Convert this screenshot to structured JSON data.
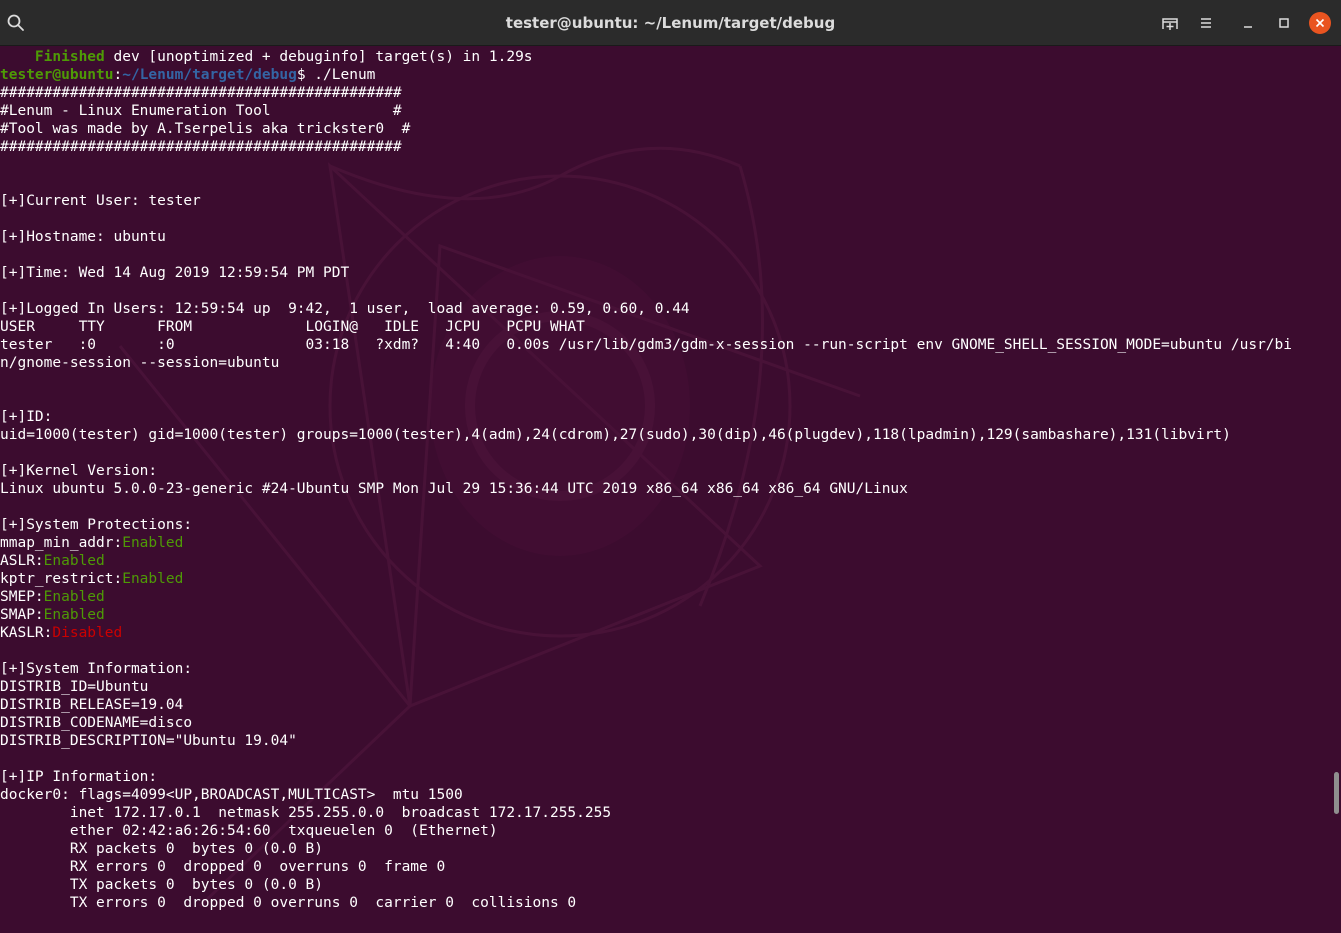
{
  "window": {
    "title": "tester@ubuntu: ~/Lenum/target/debug",
    "icons": [
      "search-icon",
      "new-tab-icon",
      "hamburger-menu-icon",
      "minimize-icon",
      "maximize-icon",
      "close-icon"
    ],
    "close_color": "#e95420"
  },
  "colors": {
    "background": "#300a24",
    "text": "#ffffff",
    "green": "#4e9a06",
    "blue": "#3465a4",
    "red": "#cc0000"
  },
  "terminal": {
    "lines": [
      [
        {
          "t": "    "
        },
        {
          "t": "Finished",
          "c": "green-b"
        },
        {
          "t": " dev [unoptimized + debuginfo] target(s) in 1.29s"
        }
      ],
      [
        {
          "t": "tester@ubuntu",
          "c": "green-b"
        },
        {
          "t": ":"
        },
        {
          "t": "~/Lenum/target/debug",
          "c": "blue-b"
        },
        {
          "t": "$ ./Lenum"
        }
      ],
      [
        {
          "t": "##############################################"
        }
      ],
      [
        {
          "t": "#Lenum - Linux Enumeration Tool              #"
        }
      ],
      [
        {
          "t": "#Tool was made by A.Tserpelis aka trickster0  #"
        }
      ],
      [
        {
          "t": "##############################################"
        }
      ],
      [
        {
          "t": ""
        }
      ],
      [
        {
          "t": ""
        }
      ],
      [
        {
          "t": "[+]Current User: tester"
        }
      ],
      [
        {
          "t": ""
        }
      ],
      [
        {
          "t": "[+]Hostname: ubuntu"
        }
      ],
      [
        {
          "t": ""
        }
      ],
      [
        {
          "t": "[+]Time: Wed 14 Aug 2019 12:59:54 PM PDT"
        }
      ],
      [
        {
          "t": ""
        }
      ],
      [
        {
          "t": "[+]Logged In Users: 12:59:54 up  9:42,  1 user,  load average: 0.59, 0.60, 0.44"
        }
      ],
      [
        {
          "t": "USER     TTY      FROM             LOGIN@   IDLE   JCPU   PCPU WHAT"
        }
      ],
      [
        {
          "t": "tester   :0       :0               03:18   ?xdm?   4:40   0.00s /usr/lib/gdm3/gdm-x-session --run-script env GNOME_SHELL_SESSION_MODE=ubuntu /usr/bi"
        }
      ],
      [
        {
          "t": "n/gnome-session --session=ubuntu"
        }
      ],
      [
        {
          "t": ""
        }
      ],
      [
        {
          "t": ""
        }
      ],
      [
        {
          "t": "[+]ID:"
        }
      ],
      [
        {
          "t": "uid=1000(tester) gid=1000(tester) groups=1000(tester),4(adm),24(cdrom),27(sudo),30(dip),46(plugdev),118(lpadmin),129(sambashare),131(libvirt)"
        }
      ],
      [
        {
          "t": ""
        }
      ],
      [
        {
          "t": "[+]Kernel Version:"
        }
      ],
      [
        {
          "t": "Linux ubuntu 5.0.0-23-generic #24-Ubuntu SMP Mon Jul 29 15:36:44 UTC 2019 x86_64 x86_64 x86_64 GNU/Linux"
        }
      ],
      [
        {
          "t": ""
        }
      ],
      [
        {
          "t": "[+]System Protections:"
        }
      ],
      [
        {
          "t": "mmap_min_addr:"
        },
        {
          "t": "Enabled",
          "c": "green"
        }
      ],
      [
        {
          "t": "ASLR:"
        },
        {
          "t": "Enabled",
          "c": "green"
        }
      ],
      [
        {
          "t": "kptr_restrict:"
        },
        {
          "t": "Enabled",
          "c": "green"
        }
      ],
      [
        {
          "t": "SMEP:"
        },
        {
          "t": "Enabled",
          "c": "green"
        }
      ],
      [
        {
          "t": "SMAP:"
        },
        {
          "t": "Enabled",
          "c": "green"
        }
      ],
      [
        {
          "t": "KASLR:"
        },
        {
          "t": "Disabled",
          "c": "red"
        }
      ],
      [
        {
          "t": ""
        }
      ],
      [
        {
          "t": "[+]System Information:"
        }
      ],
      [
        {
          "t": "DISTRIB_ID=Ubuntu"
        }
      ],
      [
        {
          "t": "DISTRIB_RELEASE=19.04"
        }
      ],
      [
        {
          "t": "DISTRIB_CODENAME=disco"
        }
      ],
      [
        {
          "t": "DISTRIB_DESCRIPTION=\"Ubuntu 19.04\""
        }
      ],
      [
        {
          "t": ""
        }
      ],
      [
        {
          "t": "[+]IP Information:"
        }
      ],
      [
        {
          "t": "docker0: flags=4099<UP,BROADCAST,MULTICAST>  mtu 1500"
        }
      ],
      [
        {
          "t": "        inet 172.17.0.1  netmask 255.255.0.0  broadcast 172.17.255.255"
        }
      ],
      [
        {
          "t": "        ether 02:42:a6:26:54:60  txqueuelen 0  (Ethernet)"
        }
      ],
      [
        {
          "t": "        RX packets 0  bytes 0 (0.0 B)"
        }
      ],
      [
        {
          "t": "        RX errors 0  dropped 0  overruns 0  frame 0"
        }
      ],
      [
        {
          "t": "        TX packets 0  bytes 0 (0.0 B)"
        }
      ],
      [
        {
          "t": "        TX errors 0  dropped 0 overruns 0  carrier 0  collisions 0"
        }
      ]
    ]
  }
}
